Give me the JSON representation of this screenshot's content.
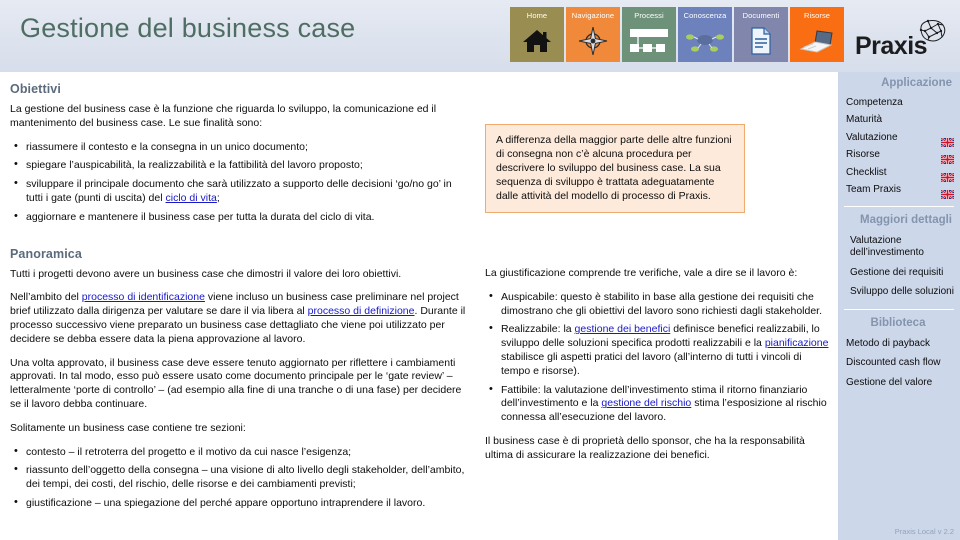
{
  "header": {
    "title": "Gestione del business case",
    "nav": [
      {
        "label": "Home",
        "icon": "house-icon",
        "color": "#998d52"
      },
      {
        "label": "Navigazione",
        "icon": "compass-icon",
        "color": "#f0893a"
      },
      {
        "label": "Processi",
        "icon": "flowchart-icon",
        "color": "#6d9279"
      },
      {
        "label": "Conoscenza",
        "icon": "network-icon",
        "color": "#6d82bd"
      },
      {
        "label": "Documenti",
        "icon": "document-icon",
        "color": "#8186ad"
      },
      {
        "label": "Risorse",
        "icon": "devices-icon",
        "color": "#f96d13"
      }
    ],
    "logo_text": "Praxis",
    "logo_mark": "brain-network-icon"
  },
  "objectives": {
    "heading": "Obiettivi",
    "intro": "La gestione del business case è la funzione che riguarda lo sviluppo, la comunicazione ed il mantenimento del business case. Le sue finalità sono:",
    "bullets": [
      {
        "pre": "riassumere il contesto e la consegna in un unico documento;",
        "link": "",
        "post": ""
      },
      {
        "pre": "spiegare l’auspicabilità, la realizzabilità e la fattibilità del lavoro proposto;",
        "link": "",
        "post": ""
      },
      {
        "pre": "sviluppare il principale documento che sarà utilizzato a supporto delle decisioni ‘go/no go’ in tutti i gate (punti di uscita) del ",
        "link": "ciclo di vita",
        "post": ";"
      },
      {
        "pre": "aggiornare e mantenere il business case per tutta la durata del ciclo di vita.",
        "link": "",
        "post": ""
      }
    ]
  },
  "callout": {
    "text": "A differenza della maggior parte delle altre funzioni di consegna non c’è alcuna procedura per descrivere lo sviluppo del business case. La sua sequenza di sviluppo è trattata adeguatamente dalle attività del modello di processo di Praxis."
  },
  "overview": {
    "heading": "Panoramica",
    "p1": "Tutti i progetti devono avere un business case che dimostri il valore dei loro obiettivi.",
    "p2_a": "Nell’ambito del ",
    "p2_link1": "processo di identificazione",
    "p2_b": " viene incluso un business case preliminare nel project brief utilizzato dalla dirigenza per valutare se dare il via libera al ",
    "p2_link2": "processo di definizione",
    "p2_c": ". Durante il processo successivo viene preparato un business case dettagliato che viene poi utilizzato per decidere se debba essere data la piena approvazione al lavoro.",
    "p3": "Una volta approvato, il business case deve essere tenuto aggiornato per riflettere i cambiamenti approvati. In tal modo, esso può essere usato come documento principale per le ‘gate review’ – letteralmente ‘porte di controllo’ – (ad esempio alla fine di una tranche o di una fase) per decidere se il lavoro debba continuare.",
    "p4": "Solitamente un business case contiene tre sezioni:",
    "bullets": [
      "contesto – il retroterra del progetto e il motivo da cui nasce l’esigenza;",
      "riassunto dell’oggetto della consegna – una visione di alto livello degli stakeholder, dell’ambito, dei tempi, dei costi, del rischio, delle risorse e dei cambiamenti previsti;",
      "giustificazione –  una spiegazione del perché appare opportuno intraprendere il lavoro."
    ]
  },
  "justification": {
    "intro": "La giustificazione comprende tre verifiche, vale a dire se il lavoro è:",
    "b1": "Auspicabile: questo è stabilito in base alla gestione dei requisiti che dimostrano che gli obiettivi del lavoro sono richiesti dagli stakeholder.",
    "b2_a": "Realizzabile: la ",
    "b2_link1": "gestione dei benefici",
    "b2_b": " definisce benefici realizzabili, lo sviluppo delle soluzioni specifica prodotti realizzabili e la ",
    "b2_link2": "pianificazione",
    "b2_c": " stabilisce gli aspetti pratici del lavoro (all’interno di tutti i vincoli di tempo e risorse).",
    "b3_a": "Fattibile: la valutazione dell’investimento stima il ritorno finanziario dell’investimento e la ",
    "b3_link1": "gestione del rischio",
    "b3_b": " stima l’esposizione al rischio connessa all’esecuzione del lavoro.",
    "closing": "Il business case è di proprietà dello sponsor, che ha la responsabilità ultima di assicurare la realizzazione dei benefici."
  },
  "sidebar": {
    "section1_title": "Applicazione",
    "section1_items": [
      {
        "label": "Competenza",
        "flag": false
      },
      {
        "label": "Maturità",
        "flag": false
      },
      {
        "label": "Valutazione",
        "flag": true
      },
      {
        "label": "Risorse",
        "flag": true
      },
      {
        "label": "Checklist",
        "flag": true
      },
      {
        "label": "Team Praxis",
        "flag": true
      }
    ],
    "section2_title": "Maggiori dettagli",
    "section2_items": [
      "Valutazione dell’investimento",
      "Gestione dei requisiti",
      "Sviluppo delle soluzioni"
    ],
    "section3_title": "Biblioteca",
    "section3_items": [
      "Metodo di payback",
      "Discounted cash flow",
      "Gestione del valore"
    ],
    "footer": "Praxis Local v 2.2"
  }
}
